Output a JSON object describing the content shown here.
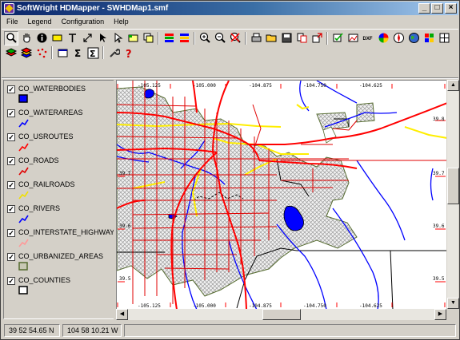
{
  "window": {
    "title": "SoftWright HDMapper - SWHDMap1.smf"
  },
  "title_buttons": {
    "minimize": "_",
    "maximize": "□",
    "close": "×"
  },
  "menu": [
    {
      "label": "File"
    },
    {
      "label": "Legend"
    },
    {
      "label": "Configuration"
    },
    {
      "label": "Help"
    }
  ],
  "toolbar1": [
    "zoom-tool",
    "pan-hand",
    "info",
    "tag",
    "text-tool",
    "resize-arrows",
    "pointer",
    "select-arrow",
    "rectangle",
    "copy-map",
    "layers-up",
    "layers-down",
    "zoom-in",
    "zoom-out",
    "zoom-cancel",
    "print",
    "open-folder",
    "save-disk",
    "copy",
    "export",
    "check-edit",
    "image-export",
    "dxf-export",
    "color-wheel",
    "compass",
    "earth",
    "grid",
    "window"
  ],
  "toolbar1_dxf_label": "DXF",
  "toolbar2": [
    "layer-add",
    "layer-stack",
    "scatter-points",
    "table-edit",
    "sum",
    "sum-box",
    "tools-wrench",
    "help-question"
  ],
  "toolbar2_labels": {
    "sum": "Σ",
    "help": "?"
  },
  "legend": {
    "layers": [
      {
        "name": "CO_WATERBODIES",
        "checked": true,
        "symbol": "fill",
        "color": "#0000ff",
        "border": "#000000"
      },
      {
        "name": "CO_WATERAREAS",
        "checked": true,
        "symbol": "line",
        "color": "#0000ff"
      },
      {
        "name": "CO_USROUTES",
        "checked": true,
        "symbol": "line",
        "color": "#ff0000"
      },
      {
        "name": "CO_ROADS",
        "checked": true,
        "symbol": "line",
        "color": "#e00000"
      },
      {
        "name": "CO_RAILROADS",
        "checked": true,
        "symbol": "line",
        "color": "#f0e000"
      },
      {
        "name": "CO_RIVERS",
        "checked": true,
        "symbol": "line",
        "color": "#0000ff"
      },
      {
        "name": "CO_INTERSTATE_HIGHWAY",
        "checked": true,
        "symbol": "line",
        "color": "#ff9999"
      },
      {
        "name": "CO_URBANIZED_AREAS",
        "checked": true,
        "symbol": "fill",
        "color": "#c8c8b4",
        "border": "#556b2f"
      },
      {
        "name": "CO_COUNTIES",
        "checked": true,
        "symbol": "fill",
        "color": "#ffffff",
        "border": "#000000"
      }
    ],
    "check_mark": "✓"
  },
  "map": {
    "top_labels": [
      "-105.125",
      "-105.000",
      "-104.875",
      "-104.750",
      "-104.625"
    ],
    "bottom_labels": [
      "-105.125",
      "-105.000",
      "-104.875",
      "-104.750",
      "-104.625"
    ],
    "left_labels": [
      "39.7",
      "39.6",
      "39.5"
    ],
    "right_labels": [
      "39.8",
      "39.7",
      "39.6",
      "39.5"
    ],
    "colors": {
      "road": "#e00000",
      "highway": "#ff0000",
      "water": "#0000ff",
      "rail": "#ffee00",
      "urban_fill": "#c8c8c8",
      "urban_border": "#556b2f",
      "county": "#000000"
    }
  },
  "status": {
    "lat": "39 52 54.65 N",
    "lon": "104 58 10.21 W",
    "extra": ""
  }
}
